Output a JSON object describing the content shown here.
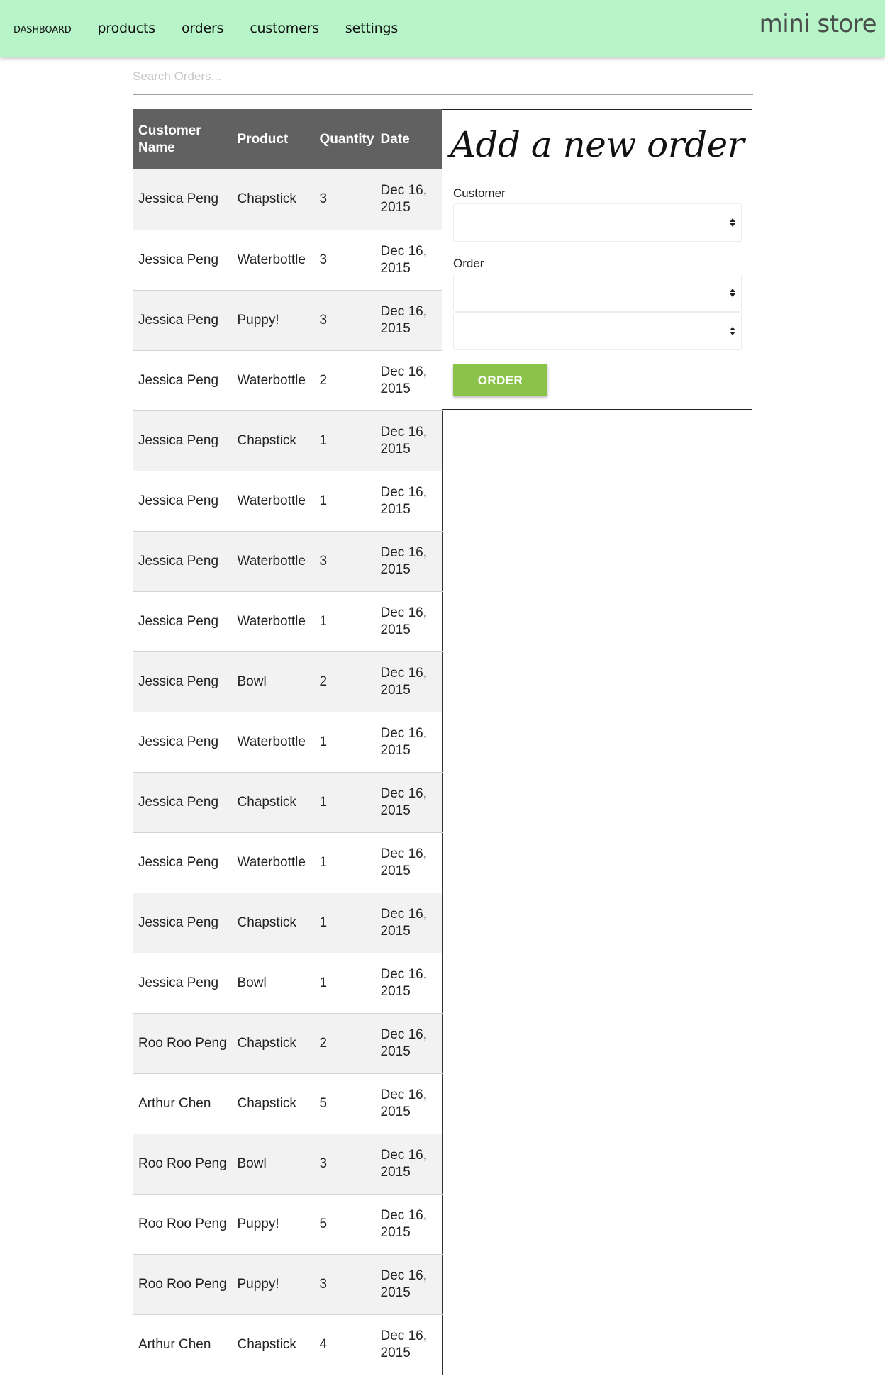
{
  "nav": {
    "links": [
      "dashboard",
      "products",
      "orders",
      "customers",
      "settings"
    ],
    "brand": "mini store"
  },
  "search": {
    "placeholder": "Search Orders...",
    "value": ""
  },
  "table": {
    "headers": {
      "customer": "Customer Name",
      "product": "Product",
      "quantity": "Quantity",
      "date": "Date"
    },
    "rows": [
      {
        "customer": "Jessica Peng",
        "product": "Chapstick",
        "quantity": "3",
        "date": "Dec 16, 2015"
      },
      {
        "customer": "Jessica Peng",
        "product": "Waterbottle",
        "quantity": "3",
        "date": "Dec 16, 2015"
      },
      {
        "customer": "Jessica Peng",
        "product": "Puppy!",
        "quantity": "3",
        "date": "Dec 16, 2015"
      },
      {
        "customer": "Jessica Peng",
        "product": "Waterbottle",
        "quantity": "2",
        "date": "Dec 16, 2015"
      },
      {
        "customer": "Jessica Peng",
        "product": "Chapstick",
        "quantity": "1",
        "date": "Dec 16, 2015"
      },
      {
        "customer": "Jessica Peng",
        "product": "Waterbottle",
        "quantity": "1",
        "date": "Dec 16, 2015"
      },
      {
        "customer": "Jessica Peng",
        "product": "Waterbottle",
        "quantity": "3",
        "date": "Dec 16, 2015"
      },
      {
        "customer": "Jessica Peng",
        "product": "Waterbottle",
        "quantity": "1",
        "date": "Dec 16, 2015"
      },
      {
        "customer": "Jessica Peng",
        "product": "Bowl",
        "quantity": "2",
        "date": "Dec 16, 2015"
      },
      {
        "customer": "Jessica Peng",
        "product": "Waterbottle",
        "quantity": "1",
        "date": "Dec 16, 2015"
      },
      {
        "customer": "Jessica Peng",
        "product": "Chapstick",
        "quantity": "1",
        "date": "Dec 16, 2015"
      },
      {
        "customer": "Jessica Peng",
        "product": "Waterbottle",
        "quantity": "1",
        "date": "Dec 16, 2015"
      },
      {
        "customer": "Jessica Peng",
        "product": "Chapstick",
        "quantity": "1",
        "date": "Dec 16, 2015"
      },
      {
        "customer": "Jessica Peng",
        "product": "Bowl",
        "quantity": "1",
        "date": "Dec 16, 2015"
      },
      {
        "customer": "Roo Roo Peng",
        "product": "Chapstick",
        "quantity": "2",
        "date": "Dec 16, 2015"
      },
      {
        "customer": "Arthur Chen",
        "product": "Chapstick",
        "quantity": "5",
        "date": "Dec 16, 2015"
      },
      {
        "customer": "Roo Roo Peng",
        "product": "Bowl",
        "quantity": "3",
        "date": "Dec 16, 2015"
      },
      {
        "customer": "Roo Roo Peng",
        "product": "Puppy!",
        "quantity": "5",
        "date": "Dec 16, 2015"
      },
      {
        "customer": "Roo Roo Peng",
        "product": "Puppy!",
        "quantity": "3",
        "date": "Dec 16, 2015"
      },
      {
        "customer": "Arthur Chen",
        "product": "Chapstick",
        "quantity": "4",
        "date": "Dec 16, 2015"
      }
    ]
  },
  "form": {
    "title": "Add a new order",
    "customer_label": "Customer",
    "customer_value": "",
    "order_label": "Order",
    "product_value": "",
    "quantity_value": "",
    "button_label": "ORDER"
  },
  "colors": {
    "nav_background": "#b7f5c9",
    "table_header": "#616161",
    "order_button": "#8bc34a"
  }
}
